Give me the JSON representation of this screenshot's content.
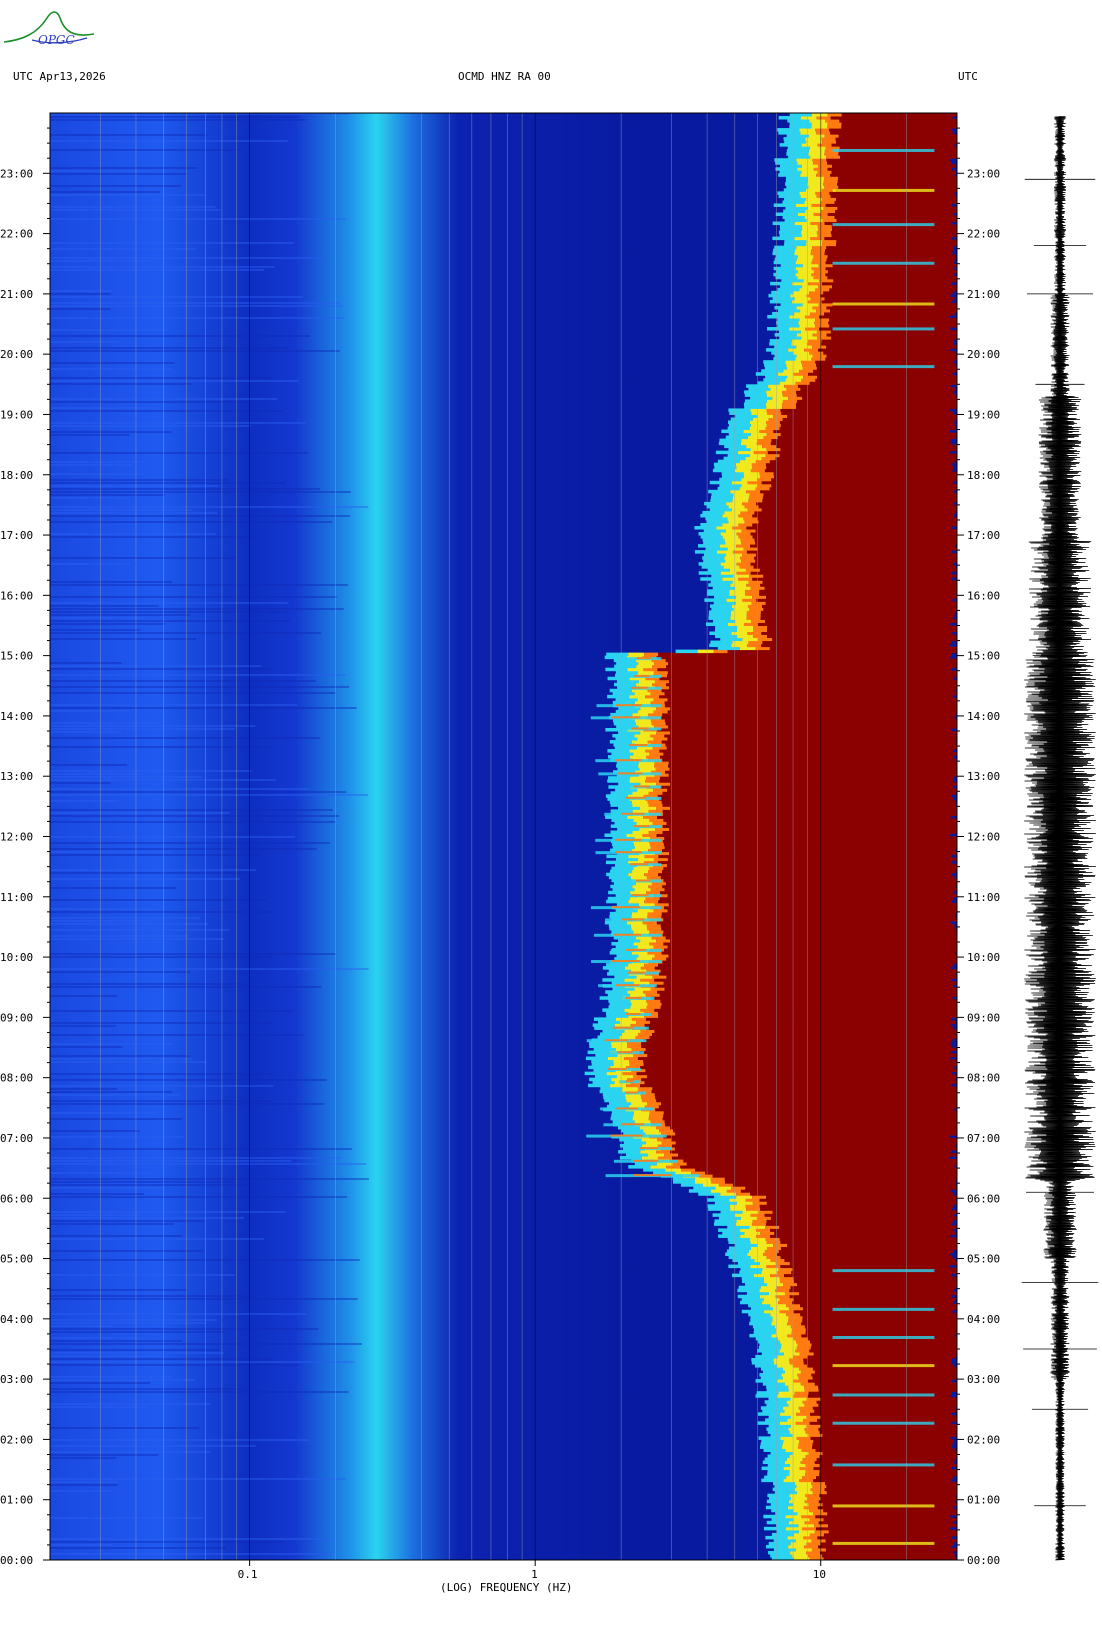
{
  "header": {
    "left": "UTC  Apr13,2026",
    "center": "OCMD HNZ RA 00",
    "right": "UTC"
  },
  "logo": {
    "text": "OPGC"
  },
  "chart_data": {
    "type": "heatmap",
    "xlabel": "(LOG) FREQUENCY (HZ)",
    "x_scale": "log",
    "xlim_hz": [
      0.02,
      30
    ],
    "x_ticks": [
      {
        "value": 0.1,
        "label": "0.1"
      },
      {
        "value": 1,
        "label": "1"
      },
      {
        "value": 10,
        "label": "10"
      }
    ],
    "y_axis": "time (UTC)",
    "ylim_hours": [
      0,
      24
    ],
    "y_ticks": [
      {
        "hour": 0,
        "label": "00:00"
      },
      {
        "hour": 1,
        "label": "01:00"
      },
      {
        "hour": 2,
        "label": "02:00"
      },
      {
        "hour": 3,
        "label": "03:00"
      },
      {
        "hour": 4,
        "label": "04:00"
      },
      {
        "hour": 5,
        "label": "05:00"
      },
      {
        "hour": 6,
        "label": "06:00"
      },
      {
        "hour": 7,
        "label": "07:00"
      },
      {
        "hour": 8,
        "label": "08:00"
      },
      {
        "hour": 9,
        "label": "09:00"
      },
      {
        "hour": 10,
        "label": "10:00"
      },
      {
        "hour": 11,
        "label": "11:00"
      },
      {
        "hour": 12,
        "label": "12:00"
      },
      {
        "hour": 13,
        "label": "13:00"
      },
      {
        "hour": 14,
        "label": "14:00"
      },
      {
        "hour": 15,
        "label": "15:00"
      },
      {
        "hour": 16,
        "label": "16:00"
      },
      {
        "hour": 17,
        "label": "17:00"
      },
      {
        "hour": 18,
        "label": "18:00"
      },
      {
        "hour": 19,
        "label": "19:00"
      },
      {
        "hour": 20,
        "label": "20:00"
      },
      {
        "hour": 21,
        "label": "21:00"
      },
      {
        "hour": 22,
        "label": "22:00"
      },
      {
        "hour": 23,
        "label": "23:00"
      }
    ],
    "grid_frequencies_hz": [
      0.03,
      0.04,
      0.05,
      0.06,
      0.07,
      0.08,
      0.09,
      0.1,
      0.2,
      0.3,
      0.4,
      0.5,
      0.6,
      0.7,
      0.8,
      0.9,
      1,
      2,
      3,
      4,
      5,
      6,
      7,
      8,
      9,
      10,
      20
    ],
    "colors": {
      "background": "#0a1fa8",
      "low": "#1a40d8",
      "mid": "#2ad4f0",
      "high": "#f2e81e",
      "orange": "#ff7a10",
      "max": "#8b0000"
    },
    "high_energy_boundary_hz": [
      {
        "hour": 0,
        "freq": 11
      },
      {
        "hour": 3,
        "freq": 10
      },
      {
        "hour": 5,
        "freq": 8
      },
      {
        "hour": 6,
        "freq": 6.5
      },
      {
        "hour": 6.5,
        "freq": 3.5
      },
      {
        "hour": 8,
        "freq": 2.5
      },
      {
        "hour": 10,
        "freq": 3
      },
      {
        "hour": 12,
        "freq": 3
      },
      {
        "hour": 15,
        "freq": 3
      },
      {
        "hour": 15.1,
        "freq": 7
      },
      {
        "hour": 17,
        "freq": 6
      },
      {
        "hour": 19,
        "freq": 8
      },
      {
        "hour": 20,
        "freq": 11
      },
      {
        "hour": 24,
        "freq": 12
      }
    ]
  }
}
